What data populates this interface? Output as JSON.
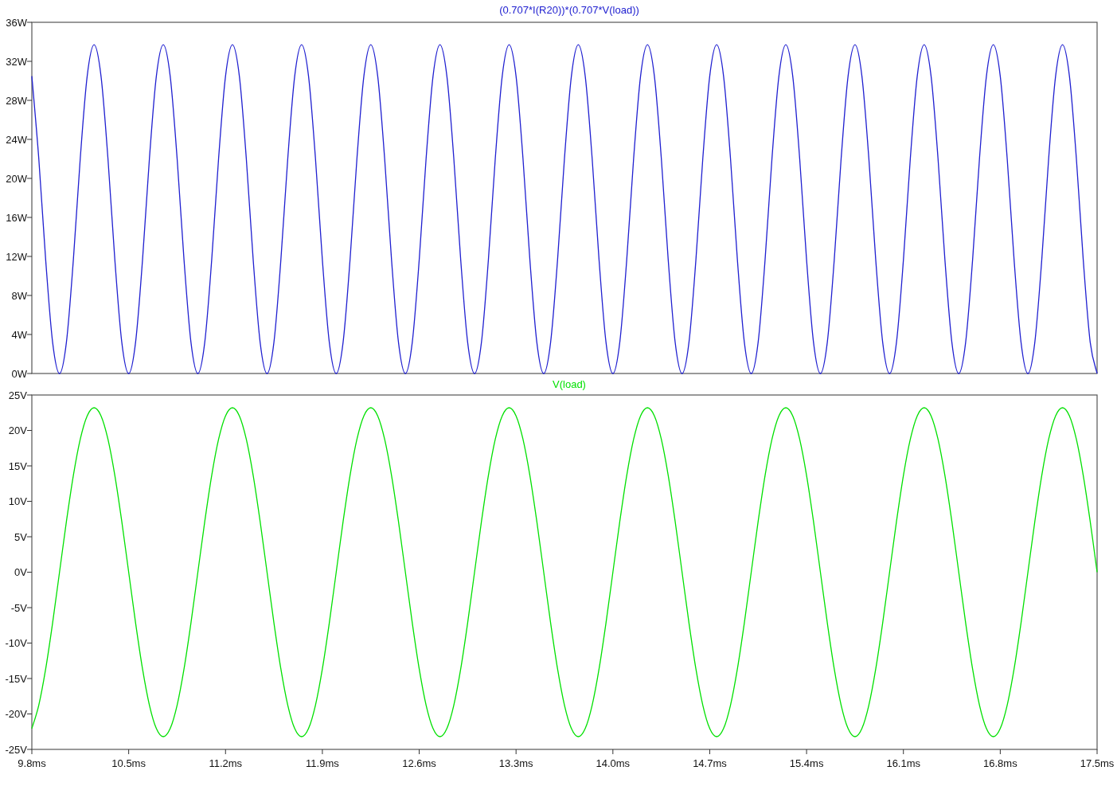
{
  "plot_panes": [
    {
      "chart_data": {
        "type": "line",
        "x": [
          9.8,
          9.85,
          9.9,
          9.95,
          10,
          10.05,
          10.1,
          10.15,
          10.2,
          10.25,
          10.3,
          10.35,
          10.4,
          10.45,
          10.5,
          10.55,
          10.6,
          10.65,
          10.7,
          10.75,
          10.8,
          10.85,
          10.9,
          10.95,
          11,
          11.05,
          11.1,
          11.15,
          11.2,
          11.25,
          11.3,
          11.35,
          11.4,
          11.45,
          11.5,
          11.55,
          11.6,
          11.65,
          11.7,
          11.75,
          11.8,
          11.85,
          11.9,
          11.95,
          12,
          12.05,
          12.1,
          12.15,
          12.2,
          12.25,
          12.3,
          12.35,
          12.4,
          12.45,
          12.5,
          12.55,
          12.6,
          12.65,
          12.7,
          12.75,
          12.8,
          12.85,
          12.9,
          12.95,
          13,
          13.05,
          13.1,
          13.15,
          13.2,
          13.25,
          13.3,
          13.35,
          13.4,
          13.45,
          13.5,
          13.55,
          13.6,
          13.65,
          13.7,
          13.75,
          13.8,
          13.85,
          13.9,
          13.95,
          14,
          14.05,
          14.1,
          14.15,
          14.2,
          14.25,
          14.3,
          14.35,
          14.4,
          14.45,
          14.5,
          14.55,
          14.6,
          14.65,
          14.7,
          14.75,
          14.8,
          14.85,
          14.9,
          14.95,
          15,
          15.05,
          15.1,
          15.15,
          15.2,
          15.25,
          15.3,
          15.35,
          15.4,
          15.45,
          15.5,
          15.55,
          15.6,
          15.65,
          15.7,
          15.75,
          15.8,
          15.85,
          15.9,
          15.95,
          16,
          16.05,
          16.1,
          16.15,
          16.2,
          16.25,
          16.3,
          16.35,
          16.4,
          16.45,
          16.5,
          16.55,
          16.6,
          16.65,
          16.7,
          16.75,
          16.8,
          16.85,
          16.9,
          16.95,
          17,
          17.05,
          17.1,
          17.15,
          17.2,
          17.25,
          17.3,
          17.35,
          17.4,
          17.45,
          17.5
        ],
        "series": [
          {
            "name": "(0.707*I(R20))*(0.707*V(load))",
            "color": "#2020d0",
            "values": [
              30.48,
              22.06,
              11.64,
              3.22,
              0,
              3.22,
              11.64,
              22.06,
              30.48,
              33.7,
              30.48,
              22.06,
              11.64,
              3.22,
              0,
              3.22,
              11.64,
              22.06,
              30.48,
              33.7,
              30.48,
              22.06,
              11.64,
              3.22,
              0,
              3.22,
              11.64,
              22.06,
              30.48,
              33.7,
              30.48,
              22.06,
              11.64,
              3.22,
              0,
              3.22,
              11.64,
              22.06,
              30.48,
              33.7,
              30.48,
              22.06,
              11.64,
              3.22,
              0,
              3.22,
              11.64,
              22.06,
              30.48,
              33.7,
              30.48,
              22.06,
              11.64,
              3.22,
              0,
              3.22,
              11.64,
              22.06,
              30.48,
              33.7,
              30.48,
              22.06,
              11.64,
              3.22,
              0,
              3.22,
              11.64,
              22.06,
              30.48,
              33.7,
              30.48,
              22.06,
              11.64,
              3.22,
              0,
              3.22,
              11.64,
              22.06,
              30.48,
              33.7,
              30.48,
              22.06,
              11.64,
              3.22,
              0,
              3.22,
              11.64,
              22.06,
              30.48,
              33.7,
              30.48,
              22.06,
              11.64,
              3.22,
              0,
              3.22,
              11.64,
              22.06,
              30.48,
              33.7,
              30.48,
              22.06,
              11.64,
              3.22,
              0,
              3.22,
              11.64,
              22.06,
              30.48,
              33.7,
              30.48,
              22.06,
              11.64,
              3.22,
              0,
              3.22,
              11.64,
              22.06,
              30.48,
              33.7,
              30.48,
              22.06,
              11.64,
              3.22,
              0,
              3.22,
              11.64,
              22.06,
              30.48,
              33.7,
              30.48,
              22.06,
              11.64,
              3.22,
              0,
              3.22,
              11.64,
              22.06,
              30.48,
              33.7,
              30.48,
              22.06,
              11.64,
              3.22,
              0,
              3.22,
              11.64,
              22.06,
              30.48,
              33.7,
              30.48,
              22.06,
              11.64,
              3.22,
              0
            ]
          }
        ],
        "xlim": [
          9.8,
          17.5
        ],
        "ylim": [
          0,
          36
        ],
        "yticks": [
          {
            "value": 0,
            "label": "0W"
          },
          {
            "value": 4,
            "label": "4W"
          },
          {
            "value": 8,
            "label": "8W"
          },
          {
            "value": 12,
            "label": "12W"
          },
          {
            "value": 16,
            "label": "16W"
          },
          {
            "value": 20,
            "label": "20W"
          },
          {
            "value": 24,
            "label": "24W"
          },
          {
            "value": 28,
            "label": "28W"
          },
          {
            "value": 32,
            "label": "32W"
          },
          {
            "value": 36,
            "label": "36W"
          }
        ]
      }
    },
    {
      "chart_data": {
        "type": "line",
        "x": [
          9.8,
          9.85,
          9.9,
          9.95,
          10,
          10.05,
          10.1,
          10.15,
          10.2,
          10.25,
          10.3,
          10.35,
          10.4,
          10.45,
          10.5,
          10.55,
          10.6,
          10.65,
          10.7,
          10.75,
          10.8,
          10.85,
          10.9,
          10.95,
          11,
          11.05,
          11.1,
          11.15,
          11.2,
          11.25,
          11.3,
          11.35,
          11.4,
          11.45,
          11.5,
          11.55,
          11.6,
          11.65,
          11.7,
          11.75,
          11.8,
          11.85,
          11.9,
          11.95,
          12,
          12.05,
          12.1,
          12.15,
          12.2,
          12.25,
          12.3,
          12.35,
          12.4,
          12.45,
          12.5,
          12.55,
          12.6,
          12.65,
          12.7,
          12.75,
          12.8,
          12.85,
          12.9,
          12.95,
          13,
          13.05,
          13.1,
          13.15,
          13.2,
          13.25,
          13.3,
          13.35,
          13.4,
          13.45,
          13.5,
          13.55,
          13.6,
          13.65,
          13.7,
          13.75,
          13.8,
          13.85,
          13.9,
          13.95,
          14,
          14.05,
          14.1,
          14.15,
          14.2,
          14.25,
          14.3,
          14.35,
          14.4,
          14.45,
          14.5,
          14.55,
          14.6,
          14.65,
          14.7,
          14.75,
          14.8,
          14.85,
          14.9,
          14.95,
          15,
          15.05,
          15.1,
          15.15,
          15.2,
          15.25,
          15.3,
          15.35,
          15.4,
          15.45,
          15.5,
          15.55,
          15.6,
          15.65,
          15.7,
          15.75,
          15.8,
          15.85,
          15.9,
          15.95,
          16,
          16.05,
          16.1,
          16.15,
          16.2,
          16.25,
          16.3,
          16.35,
          16.4,
          16.45,
          16.5,
          16.55,
          16.6,
          16.65,
          16.7,
          16.75,
          16.8,
          16.85,
          16.9,
          16.95,
          17,
          17.05,
          17.1,
          17.15,
          17.2,
          17.25,
          17.3,
          17.35,
          17.4,
          17.45,
          17.5
        ],
        "series": [
          {
            "name": "V(load)",
            "color": "#00e000",
            "values": [
              -22.06,
              -18.77,
              -13.64,
              -7.17,
              0,
              7.17,
              13.64,
              18.77,
              22.06,
              23.2,
              22.06,
              18.77,
              13.64,
              7.17,
              0,
              -7.17,
              -13.64,
              -18.77,
              -22.06,
              -23.2,
              -22.06,
              -18.77,
              -13.64,
              -7.17,
              0,
              7.17,
              13.64,
              18.77,
              22.06,
              23.2,
              22.06,
              18.77,
              13.64,
              7.17,
              0,
              -7.17,
              -13.64,
              -18.77,
              -22.06,
              -23.2,
              -22.06,
              -18.77,
              -13.64,
              -7.17,
              0,
              7.17,
              13.64,
              18.77,
              22.06,
              23.2,
              22.06,
              18.77,
              13.64,
              7.17,
              0,
              -7.17,
              -13.64,
              -18.77,
              -22.06,
              -23.2,
              -22.06,
              -18.77,
              -13.64,
              -7.17,
              0,
              7.17,
              13.64,
              18.77,
              22.06,
              23.2,
              22.06,
              18.77,
              13.64,
              7.17,
              0,
              -7.17,
              -13.64,
              -18.77,
              -22.06,
              -23.2,
              -22.06,
              -18.77,
              -13.64,
              -7.17,
              0,
              7.17,
              13.64,
              18.77,
              22.06,
              23.2,
              22.06,
              18.77,
              13.64,
              7.17,
              0,
              -7.17,
              -13.64,
              -18.77,
              -22.06,
              -23.2,
              -22.06,
              -18.77,
              -13.64,
              -7.17,
              0,
              7.17,
              13.64,
              18.77,
              22.06,
              23.2,
              22.06,
              18.77,
              13.64,
              7.17,
              0,
              -7.17,
              -13.64,
              -18.77,
              -22.06,
              -23.2,
              -22.06,
              -18.77,
              -13.64,
              -7.17,
              0,
              7.17,
              13.64,
              18.77,
              22.06,
              23.2,
              22.06,
              18.77,
              13.64,
              7.17,
              0,
              -7.17,
              -13.64,
              -18.77,
              -22.06,
              -23.2,
              -22.06,
              -18.77,
              -13.64,
              -7.17,
              0,
              7.17,
              13.64,
              18.77,
              22.06,
              23.2,
              22.06,
              18.77,
              13.64,
              7.17,
              0
            ]
          }
        ],
        "xlim": [
          9.8,
          17.5
        ],
        "ylim": [
          -25,
          25
        ],
        "xticks": [
          {
            "value": 9.8,
            "label": "9.8ms"
          },
          {
            "value": 10.5,
            "label": "10.5ms"
          },
          {
            "value": 11.2,
            "label": "11.2ms"
          },
          {
            "value": 11.9,
            "label": "11.9ms"
          },
          {
            "value": 12.6,
            "label": "12.6ms"
          },
          {
            "value": 13.3,
            "label": "13.3ms"
          },
          {
            "value": 14.0,
            "label": "14.0ms"
          },
          {
            "value": 14.7,
            "label": "14.7ms"
          },
          {
            "value": 15.4,
            "label": "15.4ms"
          },
          {
            "value": 16.1,
            "label": "16.1ms"
          },
          {
            "value": 16.8,
            "label": "16.8ms"
          },
          {
            "value": 17.5,
            "label": "17.5ms"
          }
        ],
        "yticks": [
          {
            "value": -25,
            "label": "-25V"
          },
          {
            "value": -20,
            "label": "-20V"
          },
          {
            "value": -15,
            "label": "-15V"
          },
          {
            "value": -10,
            "label": "-10V"
          },
          {
            "value": -5,
            "label": "-5V"
          },
          {
            "value": 0,
            "label": "0V"
          },
          {
            "value": 5,
            "label": "5V"
          },
          {
            "value": 10,
            "label": "10V"
          },
          {
            "value": 15,
            "label": "15V"
          },
          {
            "value": 20,
            "label": "20V"
          },
          {
            "value": 25,
            "label": "25V"
          }
        ]
      }
    }
  ]
}
